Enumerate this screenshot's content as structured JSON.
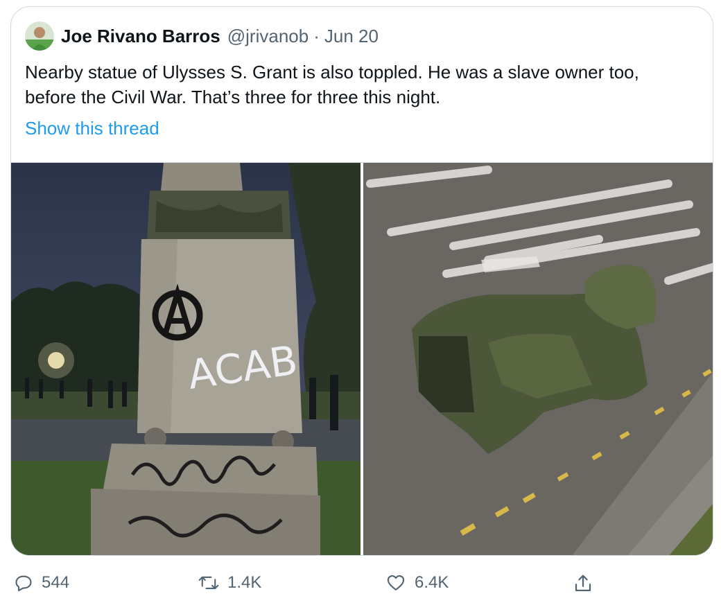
{
  "tweet": {
    "author_name": "Joe Rivano Barros",
    "handle": "@jrivanob",
    "separator": "·",
    "date": "Jun 20",
    "text": "Nearby statue of Ulysses S. Grant is also toppled. He was a slave owner too, before the Civil War. That’s three for three this night.",
    "show_thread_label": "Show this thread",
    "photos": [
      {
        "graffiti_text": "ACAB"
      },
      {
        "graffiti_text": ""
      }
    ]
  },
  "actions": {
    "reply_count": "544",
    "retweet_count": "1.4K",
    "like_count": "6.4K"
  },
  "colors": {
    "link": "#1d9bf0",
    "secondary_text": "#536471",
    "border": "#cfd9de"
  }
}
